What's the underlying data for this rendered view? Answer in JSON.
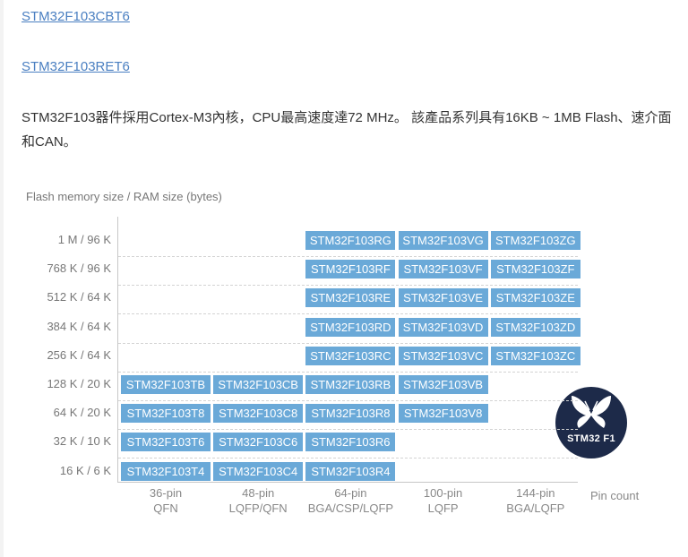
{
  "links": [
    "STM32F103CBT6",
    "STM32F103RET6"
  ],
  "description": "STM32F103器件採用Cortex-M3內核，CPU最高速度達72 MHz。 該產品系列具有16KB ~ 1MB Flash、速介面和CAN。",
  "chart_data": {
    "type": "table",
    "ylabel": "Flash memory size / RAM size (bytes)",
    "xlabel": "Pin count",
    "rows": [
      "1 M / 96 K",
      "768 K / 96 K",
      "512 K / 64 K",
      "384 K / 64 K",
      "256 K / 64 K",
      "128 K / 20 K",
      "64 K / 20 K",
      "32 K / 10 K",
      "16 K / 6 K"
    ],
    "columns": [
      {
        "pins": "36-pin",
        "package": "QFN"
      },
      {
        "pins": "48-pin",
        "package": "LQFP/QFN"
      },
      {
        "pins": "64-pin",
        "package": "BGA/CSP/LQFP"
      },
      {
        "pins": "100-pin",
        "package": "LQFP"
      },
      {
        "pins": "144-pin",
        "package": "BGA/LQFP"
      }
    ],
    "cells": [
      [
        "",
        "",
        "STM32F103RG",
        "STM32F103VG",
        "STM32F103ZG"
      ],
      [
        "",
        "",
        "STM32F103RF",
        "STM32F103VF",
        "STM32F103ZF"
      ],
      [
        "",
        "",
        "STM32F103RE",
        "STM32F103VE",
        "STM32F103ZE"
      ],
      [
        "",
        "",
        "STM32F103RD",
        "STM32F103VD",
        "STM32F103ZD"
      ],
      [
        "",
        "",
        "STM32F103RC",
        "STM32F103VC",
        "STM32F103ZC"
      ],
      [
        "STM32F103TB",
        "STM32F103CB",
        "STM32F103RB",
        "STM32F103VB",
        ""
      ],
      [
        "STM32F103T8",
        "STM32F103C8",
        "STM32F103R8",
        "STM32F103V8",
        ""
      ],
      [
        "STM32F103T6",
        "STM32F103C6",
        "STM32F103R6",
        "",
        ""
      ],
      [
        "STM32F103T4",
        "STM32F103C4",
        "STM32F103R4",
        "",
        ""
      ]
    ],
    "chip_color": "#6aa9d8",
    "logo_color": "#1d2a49"
  },
  "logo": {
    "text": "STM32 F1",
    "icon": "butterfly-icon"
  }
}
